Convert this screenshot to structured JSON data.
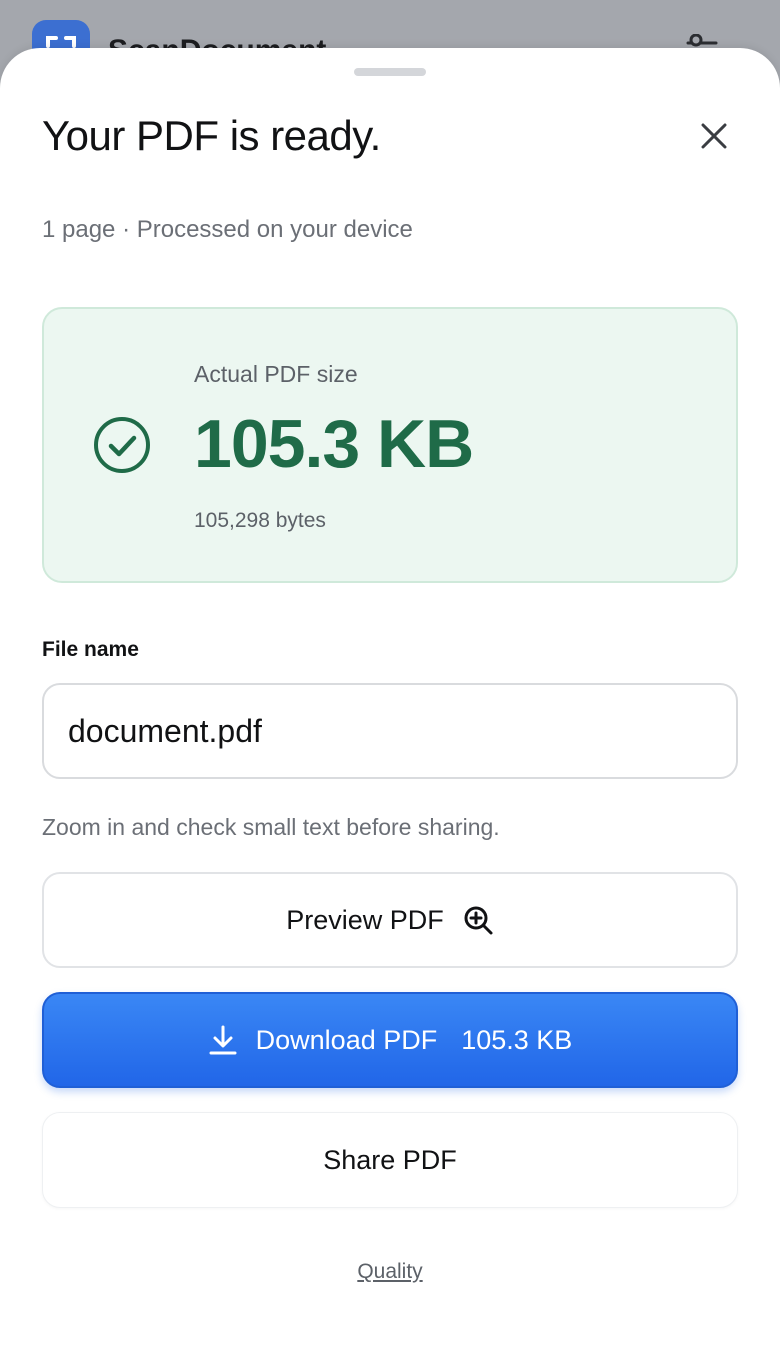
{
  "background_app": {
    "title": "ScanDocument",
    "icon": "scan-icon",
    "menu_icon": "settings-sliders-icon"
  },
  "sheet": {
    "title": "Your PDF is ready.",
    "close_icon": "close-icon",
    "subtitle": "1 page · Processed on your device",
    "size_card": {
      "label": "Actual PDF size",
      "value": "105.3 KB",
      "bytes": "105,298 bytes",
      "icon": "check-circle-icon",
      "accent_color": "#1f6b48"
    },
    "file_name": {
      "label": "File name",
      "value": "document.pdf"
    },
    "hint": "Zoom in and check small text before sharing.",
    "preview_button": {
      "label": "Preview PDF",
      "icon": "zoom-in-icon"
    },
    "download_button": {
      "label": "Download PDF",
      "size": "105.3 KB",
      "icon": "download-icon",
      "color": "#2a73ee"
    },
    "share_button": {
      "label": "Share PDF"
    },
    "quality_link": "Quality"
  }
}
